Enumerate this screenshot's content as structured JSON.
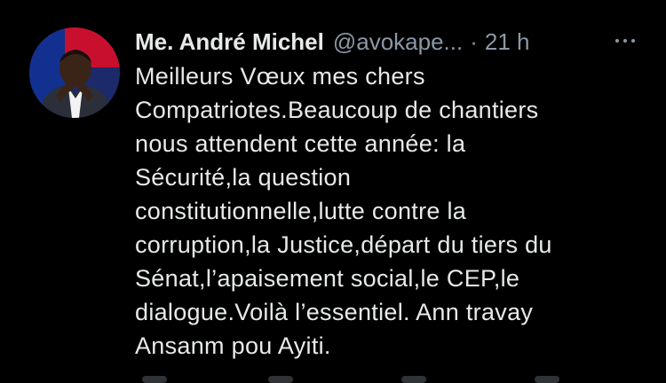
{
  "tweet": {
    "display_name": "Me. André Michel",
    "handle": "@avokape...",
    "separator": "·",
    "time": "21 h",
    "more_icon": "more-horizontal-icon",
    "text_lines": [
      "Meilleurs Vœux mes chers",
      "Compatriotes.Beaucoup de chantiers",
      "nous attendent cette année: la",
      "Sécurité,la question",
      "constitutionnelle,lutte contre la",
      "corruption,la Justice,départ du tiers du",
      "Sénat,l’apaisement social,le CEP,le",
      "dialogue.Voilà l’essentiel. Ann travay",
      "Ansanm pou Ayiti."
    ]
  },
  "colors": {
    "background": "#000000",
    "primary_text": "#e7e9ea",
    "secondary_text": "#8b98a5"
  }
}
